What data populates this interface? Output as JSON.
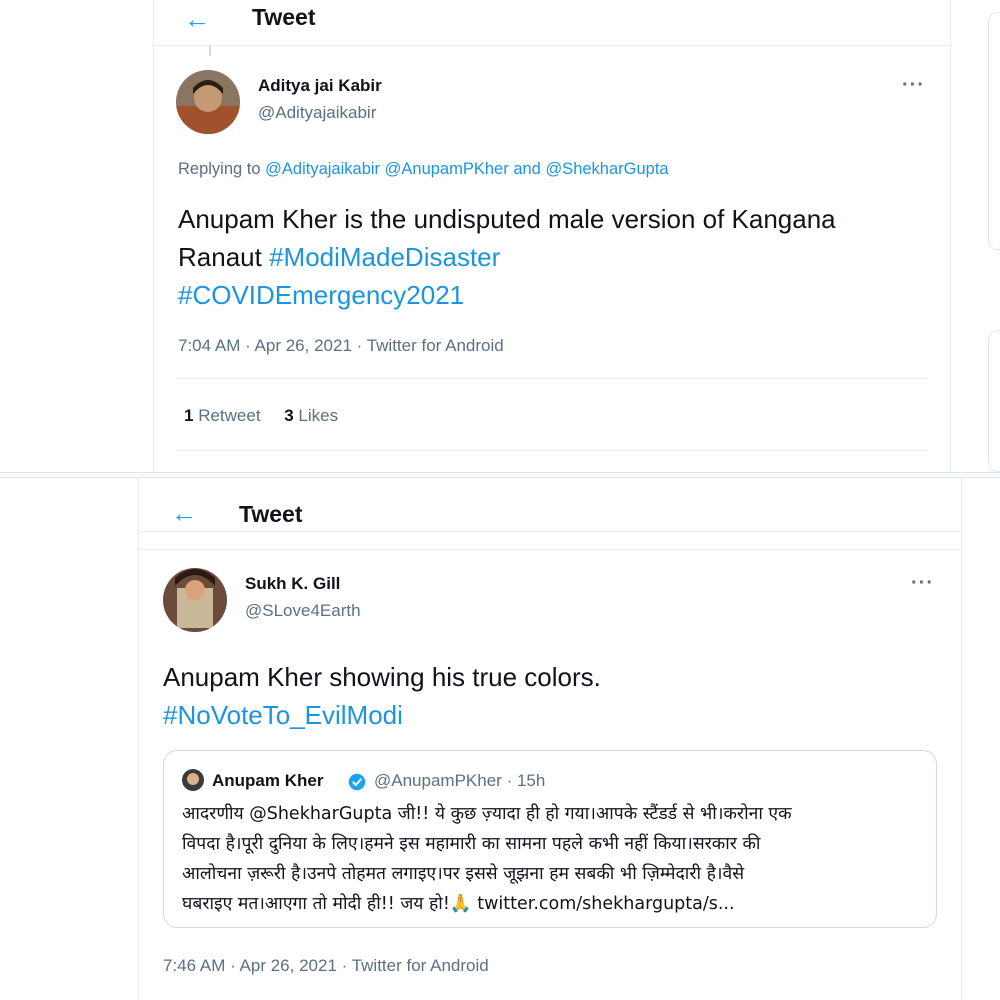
{
  "tweet1": {
    "header_title": "Tweet",
    "author_name": "Aditya jai Kabir",
    "author_handle": "@Adityajaikabir",
    "more_label": "···",
    "replying_prefix": "Replying to",
    "replying_to": [
      "@Adityajaikabir",
      "@AnupamPKher"
    ],
    "replying_and": "and",
    "replying_last": "@ShekharGupta",
    "text_plain": "Anupam Kher is the undisputed male version of Kangana Ranaut",
    "hashtags": [
      "#ModiMadeDisaster",
      "#COVIDEmergency2021"
    ],
    "timestamp": "7:04 AM · Apr 26, 2021 · Twitter for Android",
    "retweet_count": "1",
    "retweet_label": "Retweet",
    "like_count": "3",
    "like_label": "Likes"
  },
  "tweet2": {
    "header_title": "Tweet",
    "author_name": "Sukh K. Gill",
    "author_handle": "@SLove4Earth",
    "more_label": "···",
    "text_plain": "Anupam Kher showing his true colors.",
    "hashtag": "#NoVoteTo_EvilModi",
    "quoted": {
      "author_name": "Anupam Kher",
      "author_handle": "@AnupamPKher",
      "age": "· 15h",
      "text_lines": [
        "आदरणीय @ShekharGupta जी!! ये कुछ ज़्यादा ही हो गया।आपके स्टैंडर्ड से भी।करोना एक",
        "विपदा है।पूरी दुनिया के लिए।हमने इस महामारी का सामना पहले कभी नहीं किया।सरकार की",
        "आलोचना ज़रूरी है।उनपे तोहमत लगाइए।पर इससे जूझना हम सबकी भी ज़िम्मेदारी है।वैसे",
        "घबराइए मत।आएगा तो मोदी ही!! जय हो!🙏 twitter.com/shekhargupta/s..."
      ]
    },
    "timestamp": "7:46 AM · Apr 26, 2021 · Twitter for Android"
  },
  "colors": {
    "accent": "#1da1f2",
    "link": "#1b95e0",
    "muted": "#5b7083",
    "text": "#0f1419"
  },
  "icons": {
    "back": "arrow-left-icon",
    "more": "more-dots-icon",
    "verified": "verified-badge-icon"
  }
}
